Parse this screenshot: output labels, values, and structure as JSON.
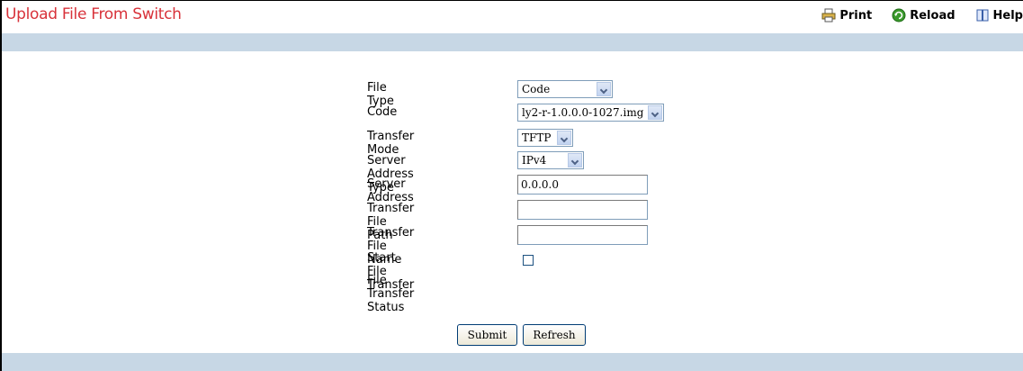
{
  "page": {
    "title": "Upload File From Switch"
  },
  "toolbar": {
    "print": "Print",
    "reload": "Reload",
    "help": "Help"
  },
  "form": {
    "file_type": {
      "label": "File Type",
      "value": "Code"
    },
    "code": {
      "label": "Code",
      "value": "ly2-r-1.0.0.0-1027.img"
    },
    "transfer_mode": {
      "label": "Transfer Mode",
      "value": "TFTP"
    },
    "server_address_type": {
      "label": "Server Address Type",
      "value": "IPv4"
    },
    "server_address": {
      "label": "Server Address",
      "value": "0.0.0.0"
    },
    "transfer_file_path": {
      "label": "Transfer File Path",
      "value": ""
    },
    "transfer_file_name": {
      "label": "Transfer File Name",
      "value": ""
    },
    "start_file_transfer": {
      "label": "Start File Transfer",
      "checked": false
    },
    "file_transfer_status": {
      "label": "File Transfer Status",
      "value": ""
    }
  },
  "buttons": {
    "submit": "Submit",
    "refresh": "Refresh"
  },
  "colors": {
    "title": "#d8323a",
    "band": "#c7d7e5",
    "input_border": "#7f9db9"
  }
}
